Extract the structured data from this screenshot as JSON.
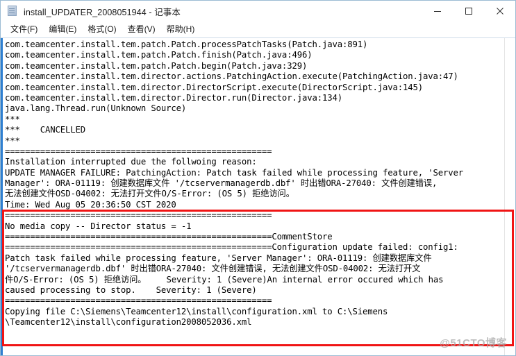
{
  "window": {
    "title": "install_UPDATER_2008051944 - 记事本",
    "icon": "notepad-icon",
    "controls": [
      {
        "name": "minimize",
        "glyph": "minimize-icon"
      },
      {
        "name": "maximize",
        "glyph": "maximize-icon"
      },
      {
        "name": "close",
        "glyph": "close-icon"
      }
    ]
  },
  "menubar": {
    "items": [
      {
        "label": "文件(F)",
        "name": "menu-file"
      },
      {
        "label": "编辑(E)",
        "name": "menu-edit"
      },
      {
        "label": "格式(O)",
        "name": "menu-format"
      },
      {
        "label": "查看(V)",
        "name": "menu-view"
      },
      {
        "label": "帮助(H)",
        "name": "menu-help"
      }
    ]
  },
  "editor": {
    "lines": [
      "com.teamcenter.install.tem.patch.Patch.processPatchTasks(Patch.java:891)",
      "com.teamcenter.install.tem.patch.Patch.finish(Patch.java:496)",
      "com.teamcenter.install.tem.patch.Patch.begin(Patch.java:329)",
      "com.teamcenter.install.tem.director.actions.PatchingAction.execute(PatchingAction.java:47)",
      "com.teamcenter.install.tem.director.DirectorScript.execute(DirectorScript.java:145)",
      "com.teamcenter.install.tem.director.Director.run(Director.java:134)",
      "java.lang.Thread.run(Unknown Source)",
      "***",
      "***    CANCELLED",
      "***",
      "=====================================================",
      "Installation interrupted due the follwoing reason:",
      "UPDATE MANAGER FAILURE: PatchingAction: Patch task failed while processing feature, 'Server",
      "Manager': ORA-01119: 创建数据库文件 '/tcservermanagerdb.dbf' 时出错ORA-27040: 文件创建错误,",
      "无法创建文件OSD-04002: 无法打开文件O/S-Error: (OS 5) 拒绝访问。",
      "Time: Wed Aug 05 20:36:50 CST 2020",
      "=====================================================",
      "No media copy -- Director status = -1",
      "=====================================================CommentStore",
      "=====================================================Configuration update failed: config1:",
      "Patch task failed while processing feature, 'Server Manager': ORA-01119: 创建数据库文件",
      "'/tcservermanagerdb.dbf' 时出错ORA-27040: 文件创建错误, 无法创建文件OSD-04002: 无法打开文",
      "件O/S-Error: (OS 5) 拒绝访问。    Severity: 1 (Severe)An internal error occured which has",
      "caused processing to stop.    Severity: 1 (Severe)",
      "=====================================================",
      "Copying file C:\\Siemens\\Teamcenter12\\install\\configuration.xml to C:\\Siemens",
      "\\Teamcenter12\\install\\configuration2008052036.xml"
    ]
  },
  "highlight": {
    "name": "error-highlight-box",
    "color": "#f01414",
    "start_line_index": 12,
    "end_line_index": 23
  },
  "watermark": {
    "text": "@51CTO博客"
  }
}
